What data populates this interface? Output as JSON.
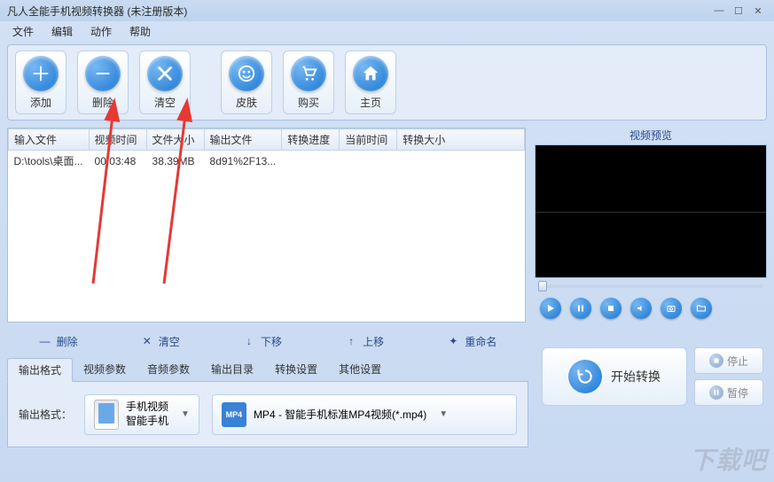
{
  "window": {
    "title": "凡人全能手机视频转换器   (未注册版本)"
  },
  "menu": {
    "file": "文件",
    "edit": "编辑",
    "action": "动作",
    "help": "帮助"
  },
  "toolbar": {
    "add": "添加",
    "delete": "删除",
    "clear": "清空",
    "skin": "皮肤",
    "buy": "购买",
    "home": "主页"
  },
  "table": {
    "cols": {
      "input": "输入文件",
      "duration": "视频时间",
      "filesize": "文件大小",
      "output": "输出文件",
      "progress": "转换进度",
      "curtime": "当前时间",
      "convsize": "转换大小"
    },
    "rows": [
      {
        "input": "D:\\tools\\桌面...",
        "duration": "00:03:48",
        "filesize": "38.39MB",
        "output": "8d91%2F13...",
        "progress": "",
        "curtime": "",
        "convsize": ""
      }
    ]
  },
  "list_actions": {
    "delete": "删除",
    "clear": "清空",
    "down": "下移",
    "up": "上移",
    "rename": "重命名"
  },
  "preview": {
    "title": "视频预览"
  },
  "tabs": {
    "out_format": "输出格式",
    "video_params": "视频参数",
    "audio_params": "音频参数",
    "out_dir": "输出目录",
    "conv_settings": "转换设置",
    "other": "其他设置"
  },
  "output_panel": {
    "label": "输出格式：",
    "device": {
      "line1": "手机视频",
      "line2": "智能手机"
    },
    "format": {
      "text": "MP4 - 智能手机标准MP4视频(*.mp4)",
      "badge": "MP4"
    }
  },
  "actions": {
    "convert": "开始转换",
    "stop": "停止",
    "pause": "暂停"
  },
  "watermark": "下载吧"
}
